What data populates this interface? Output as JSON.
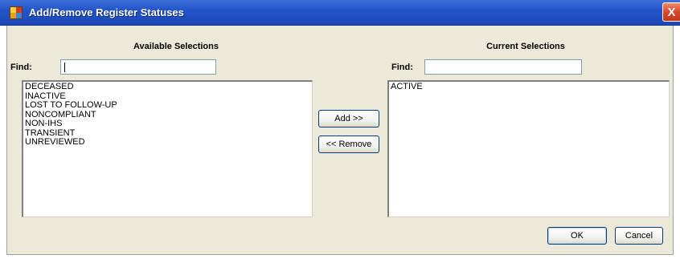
{
  "window": {
    "title": "Add/Remove Register Statuses",
    "close_label": "X"
  },
  "available": {
    "header": "Available Selections",
    "find_label": "Find:",
    "find_value": "",
    "items": [
      "DECEASED",
      "INACTIVE",
      "LOST TO FOLLOW-UP",
      "NONCOMPLIANT",
      "NON-IHS",
      "TRANSIENT",
      "UNREVIEWED"
    ]
  },
  "current": {
    "header": "Current Selections",
    "find_label": "Find:",
    "find_value": "",
    "items": [
      "ACTIVE"
    ]
  },
  "buttons": {
    "add": "Add >>",
    "remove": "<< Remove",
    "ok": "OK",
    "cancel": "Cancel"
  }
}
